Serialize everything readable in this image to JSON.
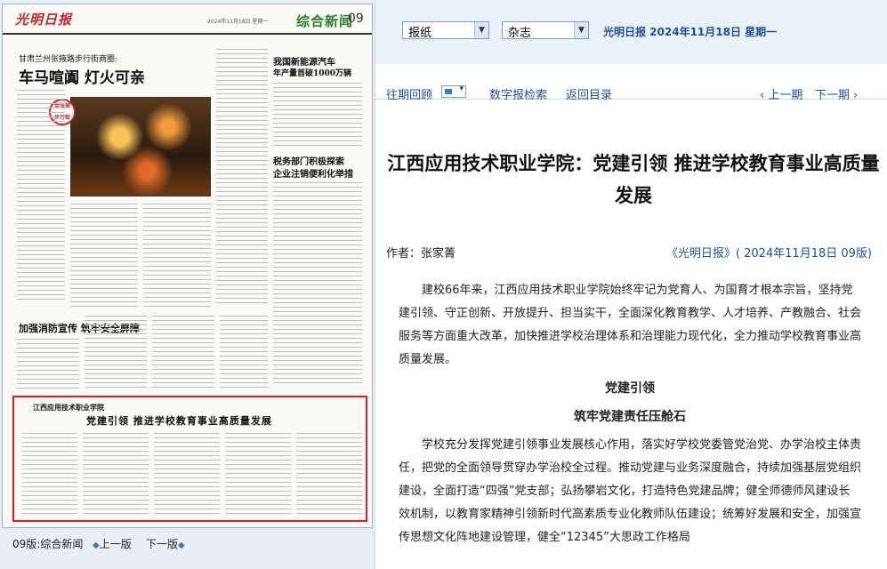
{
  "left_page": {
    "masthead": "光明日报",
    "header_meta": "2024年11月18日 星期一",
    "section_title": "综合新闻",
    "page_num": "09",
    "kicker1": "甘肃兰州张掖路步行街商圈:",
    "headline1": "车马喧阗 灯火可亲",
    "headline2_kicker": "我国新能源汽车",
    "headline2_sub": "年产量首破1000万辆",
    "headline3_line1": "税务部门积极探索",
    "headline3_line2": "企业注销便利化举措",
    "headline4": "加强消防宣传 筑牢安全屏障",
    "photo_badge": "金张掖 步行街",
    "highlight_kicker": "江西应用技术职业学院",
    "highlight_headline": "党建引领 推进学校教育事业高质量发展",
    "footer": {
      "edition": "09版:综合新闻",
      "prev": "上一版",
      "next": "下一版"
    }
  },
  "topbar": {
    "select_paper": "报纸",
    "select_magazine": "杂志",
    "pub_date": "光明日报 2024年11月18日 星期一"
  },
  "nav": {
    "archive": "往期回顾",
    "search": "数字报检索",
    "home": "返回目录",
    "prev": "‹ 上一期",
    "next": "下一期 ›"
  },
  "article": {
    "title": "江西应用技术职业学院：党建引领 推进学校教育事业高质量发展",
    "byline": "作者：张家菁",
    "source": "《光明日报》( 2024年11月18日 09版)",
    "paragraphs": [
      "建校66年来，江西应用技术职业学院始终牢记为党育人、为国育才根本宗旨，坚持党建引领、守正创新、开放提升、担当实干，全面深化教育教学、人才培养、产教融合、社会服务等方面重大改革，加快推进学校治理体系和治理能力现代化，全力推动学校教育事业高质量发展。"
    ],
    "subhead1": "党建引领",
    "subhead2": "筑牢党建责任压舱石",
    "paragraph2": "学校充分发挥党建引领事业发展核心作用，落实好学校党委管党治党、办学治校主体责任，把党的全面领导贯穿办学治校全过程。推动党建与业务深度融合，持续加强基层党组织建设，全面打造“四强”党支部；弘扬攀岩文化，打造特色党建品牌；健全师德师风建设长效机制，以教育家精神引领新时代高素质专业化教师队伍建设；统筹好发展和安全，加强宣传思想文化阵地建设管理，健全“12345”大思政工作格局"
  },
  "colors": {
    "accent_blue": "#1f4e99",
    "highlight_red": "#e02020",
    "section_green": "#2d7d2d"
  }
}
